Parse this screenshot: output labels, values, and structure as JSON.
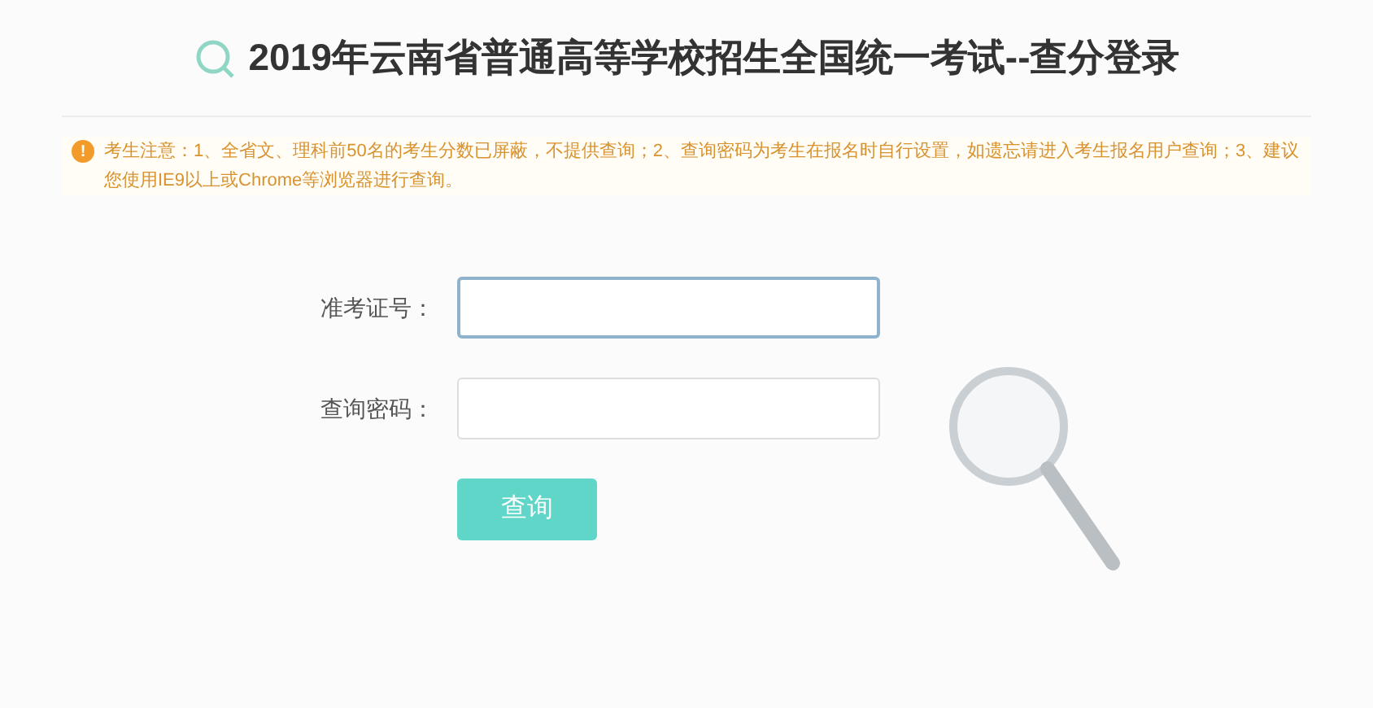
{
  "header": {
    "title": "2019年云南省普通高等学校招生全国统一考试--查分登录"
  },
  "notice": {
    "icon": "!",
    "text": "考生注意：1、全省文、理科前50名的考生分数已屏蔽，不提供查询；2、查询密码为考生在报名时自行设置，如遗忘请进入考生报名用户查询；3、建议您使用IE9以上或Chrome等浏览器进行查询。"
  },
  "form": {
    "fields": [
      {
        "label": "准考证号：",
        "focused": true
      },
      {
        "label": "查询密码：",
        "focused": false
      }
    ],
    "submit": "查询"
  }
}
